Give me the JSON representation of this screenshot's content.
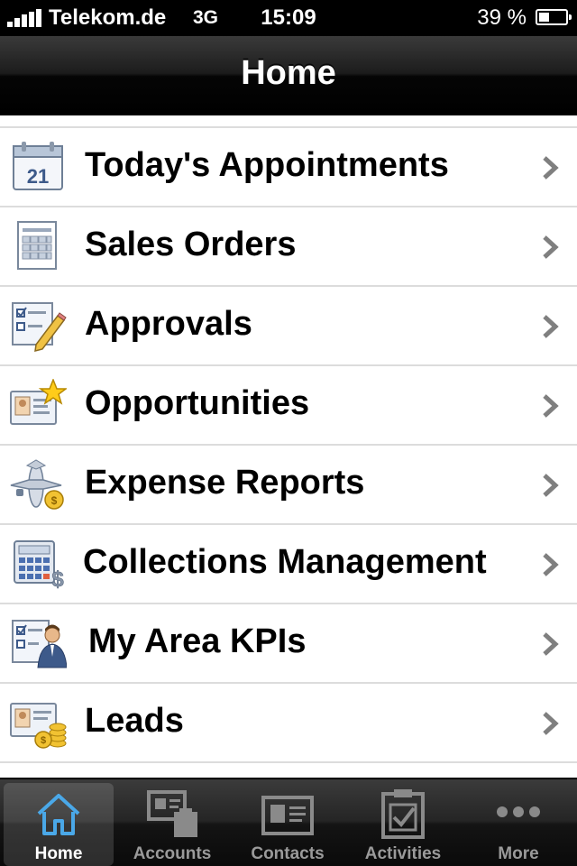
{
  "status_bar": {
    "carrier": "Telekom.de",
    "network": "3G",
    "time": "15:09",
    "battery": "39 %",
    "battery_level": 0.39
  },
  "navbar": {
    "title": "Home"
  },
  "list": {
    "items": [
      {
        "label": "Today's Appointments",
        "icon": "calendar-icon"
      },
      {
        "label": "Sales Orders",
        "icon": "sales-order-form-icon"
      },
      {
        "label": "Approvals",
        "icon": "checklist-pencil-icon"
      },
      {
        "label": "Opportunities",
        "icon": "contact-card-star-icon"
      },
      {
        "label": "Expense Reports",
        "icon": "airplane-coin-icon"
      },
      {
        "label": "Collections Management",
        "icon": "calculator-dollar-icon"
      },
      {
        "label": "My Area KPIs",
        "icon": "checklist-person-icon"
      },
      {
        "label": "Leads",
        "icon": "contact-card-coins-icon"
      }
    ],
    "calendar_day": "21"
  },
  "tabbar": {
    "tabs": [
      {
        "label": "Home",
        "icon": "home-icon",
        "active": true
      },
      {
        "label": "Accounts",
        "icon": "accounts-icon",
        "active": false
      },
      {
        "label": "Contacts",
        "icon": "contacts-card-icon",
        "active": false
      },
      {
        "label": "Activities",
        "icon": "clipboard-check-icon",
        "active": false
      },
      {
        "label": "More",
        "icon": "more-dots-icon",
        "active": false
      }
    ]
  },
  "colors": {
    "tab_active": "#ffffff",
    "tab_inactive": "#9a9a9a",
    "home_icon": "#4aa8e8",
    "separator": "#dcdcdc"
  }
}
